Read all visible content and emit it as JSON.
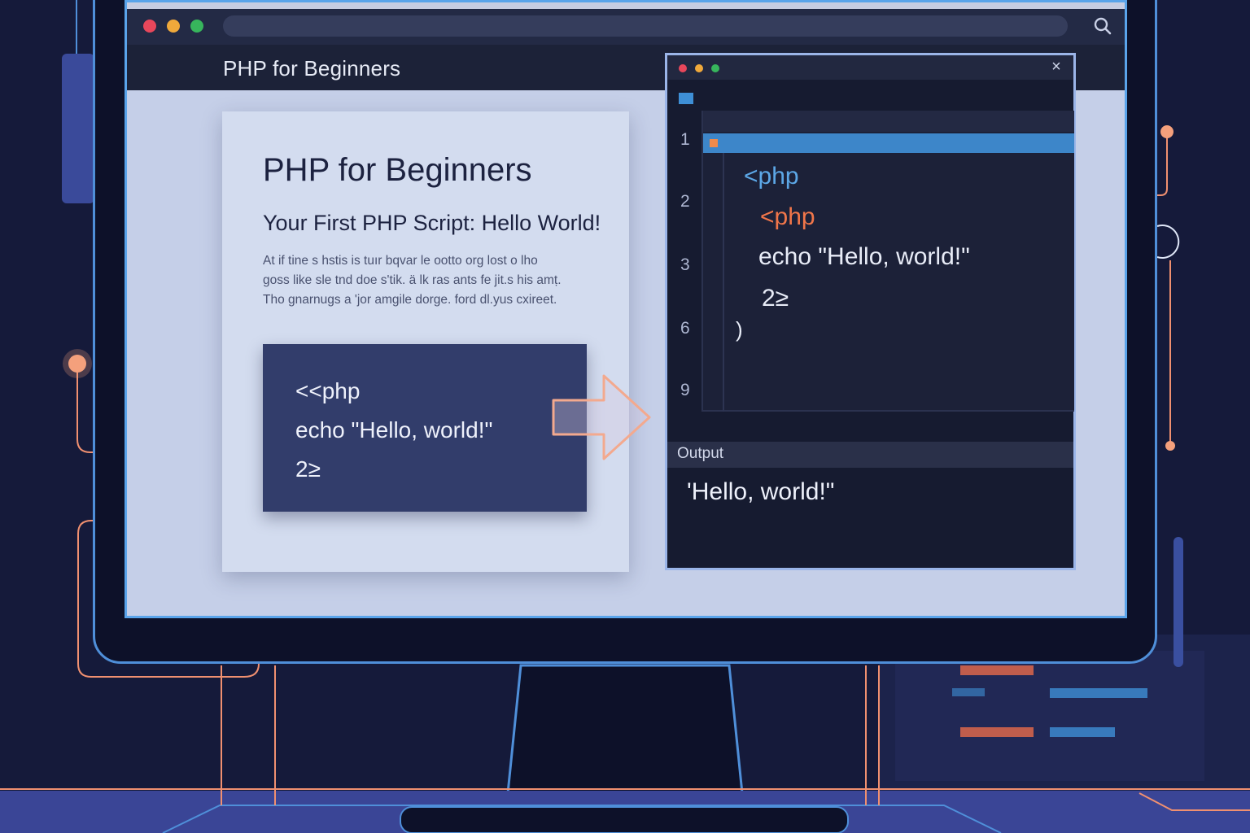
{
  "browser": {
    "site_title": "PHP for Beginners"
  },
  "article": {
    "title": "PHP for Beginners",
    "subtitle": "Your First PHP Script: Hello World!",
    "body_lines": [
      "At if tine s hstis is tuır bqvar le ootto org lost o lho",
      "goss like sle tnd doe s'tik. ä lk ras ants fe jit.s his amṭ.",
      "Tho gnarnugs a 'jor amgile dorge. ford dl.yus cxireet."
    ],
    "code_lines": [
      "<<php",
      "echo  \"Hello, world!\"",
      "2≥"
    ]
  },
  "editor": {
    "close_glyph": "×",
    "line_numbers": [
      "1",
      "2",
      "3",
      "6",
      "9"
    ],
    "code": {
      "open_tag_1": "<php",
      "open_tag_2": "<php",
      "echo": "echo \"Hello, world!\"",
      "close_tag": "2≥",
      "brace": ")"
    },
    "output_label": "Output",
    "output_text": "'Hello, world!\""
  },
  "colors": {
    "accent_blue": "#5aa4ea",
    "accent_orange": "#f0764a",
    "background": "#151a3a"
  },
  "icons": {
    "search": "search-icon",
    "close": "close-icon",
    "file": "file-icon",
    "arrow": "arrow-right-icon"
  }
}
